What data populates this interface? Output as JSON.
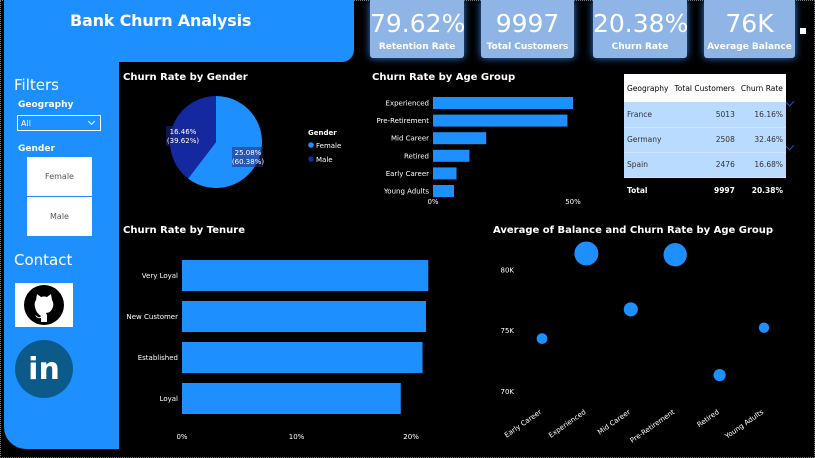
{
  "header": {
    "title": "Bank Churn Analysis"
  },
  "kpis": [
    {
      "value": "79.62%",
      "label": "Retention Rate"
    },
    {
      "value": "9997",
      "label": "Total Customers"
    },
    {
      "value": "20.38%",
      "label": "Churn Rate"
    },
    {
      "value": "76K",
      "label": "Average Balance"
    }
  ],
  "sidebar": {
    "filters_title": "Filters",
    "geography_label": "Geography",
    "geography_value": "All",
    "gender_label": "Gender",
    "gender_options": [
      "Female",
      "Male"
    ],
    "contact_title": "Contact",
    "github_icon": "github-icon",
    "linkedin_label": "in"
  },
  "colors": {
    "accent": "#1e8fff",
    "dark_blue": "#1428a0",
    "kpi_bg": "#8fb5e6"
  },
  "chart_titles": {
    "gender": "Churn Rate by Gender",
    "age": "Churn Rate by Age Group",
    "tenure": "Churn Rate by Tenure",
    "balance": "Average of Balance and Churn Rate by Age Group"
  },
  "gender_legend_title": "Gender",
  "table": {
    "headers": [
      "Geography",
      "Total Customers",
      "Churn Rate"
    ],
    "rows": [
      [
        "France",
        "5013",
        "16.16%"
      ],
      [
        "Germany",
        "2508",
        "32.46%"
      ],
      [
        "Spain",
        "2476",
        "16.68%"
      ]
    ],
    "total": [
      "Total",
      "9997",
      "20.38%"
    ]
  },
  "chart_data": [
    {
      "type": "pie",
      "title": "Churn Rate by Gender",
      "legend_title": "Gender",
      "labels": [
        "Female",
        "Male"
      ],
      "values": [
        25.08,
        16.46
      ],
      "data_labels": [
        "25.08%\n(60.38%)",
        "16.46%\n(39.62%)"
      ],
      "colors": [
        "#1e8fff",
        "#1428a0"
      ],
      "legend_placement": "right"
    },
    {
      "type": "bar",
      "orientation": "horizontal",
      "title": "Churn Rate by Age Group",
      "categories": [
        "Experienced",
        "Pre-Retirement",
        "Mid Career",
        "Retired",
        "Early Career",
        "Young Adults"
      ],
      "values": [
        50,
        48,
        19,
        13,
        8.4,
        7.5
      ],
      "x_ticks": [
        "0%",
        "50%"
      ],
      "xlim": [
        0,
        55
      ],
      "color": "#1e8fff"
    },
    {
      "type": "bar",
      "orientation": "horizontal",
      "title": "Churn Rate by Tenure",
      "categories": [
        "Very Loyal",
        "New Customer",
        "Established",
        "Loyal"
      ],
      "values": [
        21.5,
        21.3,
        21.0,
        19.1
      ],
      "x_ticks": [
        "0%",
        "10%",
        "20%"
      ],
      "xlim": [
        0,
        22
      ],
      "color": "#1e8fff"
    },
    {
      "type": "scatter",
      "title": "Average of Balance and Churn Rate by Age Group",
      "categories": [
        "Early Career",
        "Experienced",
        "Mid Career",
        "Pre-Retirement",
        "Retired",
        "Young Adults"
      ],
      "balance": [
        74300,
        81300,
        76700,
        81200,
        71300,
        75200
      ],
      "churn_rate": [
        8.4,
        50,
        19,
        48,
        13,
        7.5
      ],
      "y_ticks": [
        "70K",
        "75K",
        "80K"
      ],
      "ylim": [
        69000,
        82000
      ],
      "color": "#1e8fff"
    }
  ]
}
